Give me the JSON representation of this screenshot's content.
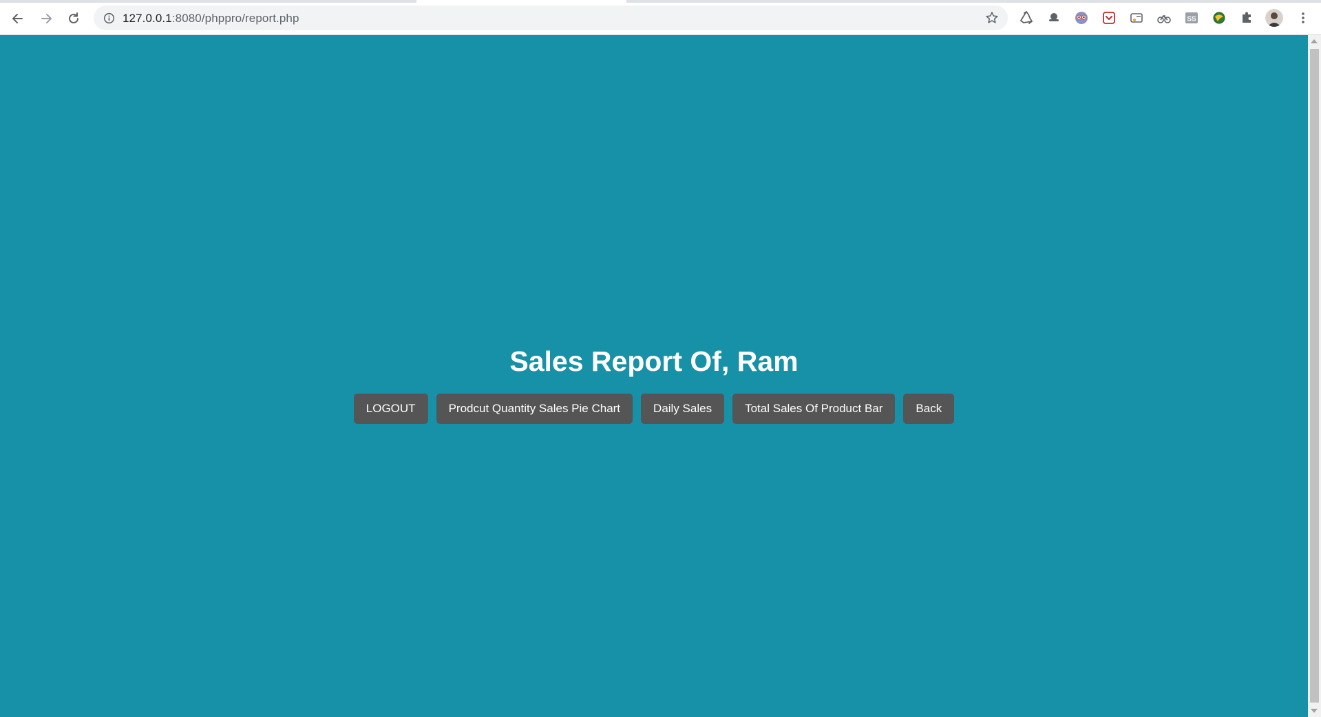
{
  "browser": {
    "url_host": "127.0.0.1",
    "url_path": ":8080/phppro/report.php",
    "colors": {
      "toolbar": "#ffffff",
      "omnibox": "#f1f3f4"
    }
  },
  "icons": {
    "back": "arrow-left",
    "forward": "arrow-right",
    "reload": "reload",
    "site_info": "info",
    "bookmark": "star",
    "extensions": [
      "recycle",
      "incognito-cap",
      "owl",
      "pocket",
      "media",
      "bike",
      "ss",
      "globe",
      "puzzle"
    ],
    "profile": "avatar",
    "menu": "kebab"
  },
  "page": {
    "background": "#1791a8",
    "title": "Sales Report Of, Ram",
    "buttons": [
      {
        "label": "LOGOUT"
      },
      {
        "label": "Prodcut Quantity Sales Pie Chart"
      },
      {
        "label": "Daily Sales"
      },
      {
        "label": "Total Sales Of Product Bar"
      },
      {
        "label": "Back"
      }
    ],
    "button_color": "#555555"
  }
}
